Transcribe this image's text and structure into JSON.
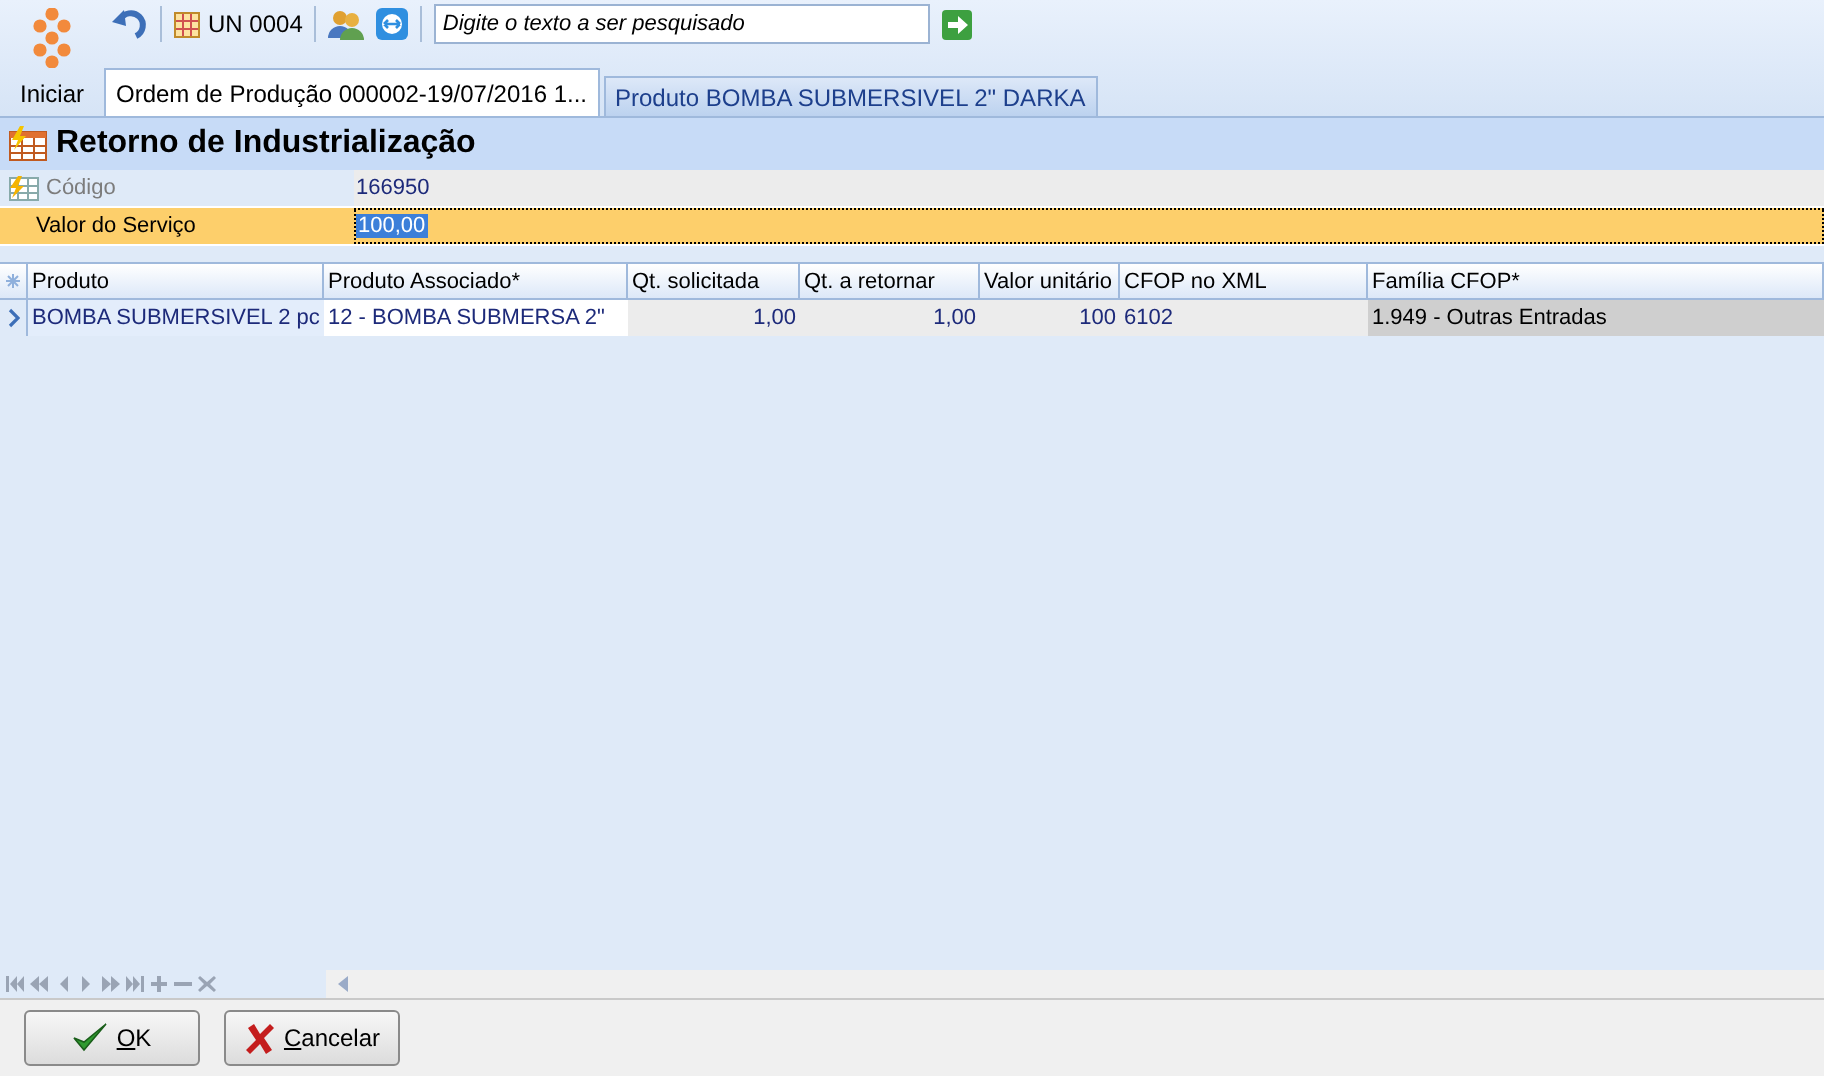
{
  "toolbar": {
    "start_label": "Iniciar",
    "unit": "UN 0004",
    "search": {
      "placeholder": "Digite o texto a ser pesquisado"
    }
  },
  "tabs": [
    {
      "label": "Ordem de Produção 000002-19/07/2016 1...",
      "selected": true
    },
    {
      "label": "Produto BOMBA SUBMERSIVEL 2\" DARKA",
      "selected": false
    }
  ],
  "form": {
    "title": "Retorno de Industrialização",
    "fields": [
      {
        "label": "Código",
        "value": "166950",
        "focused": false
      },
      {
        "label": "Valor do Serviço",
        "value": "100,00",
        "focused": true
      }
    ]
  },
  "table": {
    "columns": [
      "Produto",
      "Produto Associado*",
      "Qt. solicitada",
      "Qt. a retornar",
      "Valor unitário",
      "CFOP no XML",
      "Família CFOP*"
    ],
    "rows": [
      {
        "selected": true,
        "cells": [
          "BOMBA SUBMERSIVEL 2 pc",
          "12 - BOMBA SUBMERSA 2\"",
          "1,00",
          "1,00",
          "100",
          "6102",
          "1.949 - Outras Entradas"
        ]
      }
    ]
  },
  "buttons": [
    {
      "kind": "ok",
      "label": "OK"
    },
    {
      "kind": "cancel",
      "label": "Cancelar"
    }
  ]
}
